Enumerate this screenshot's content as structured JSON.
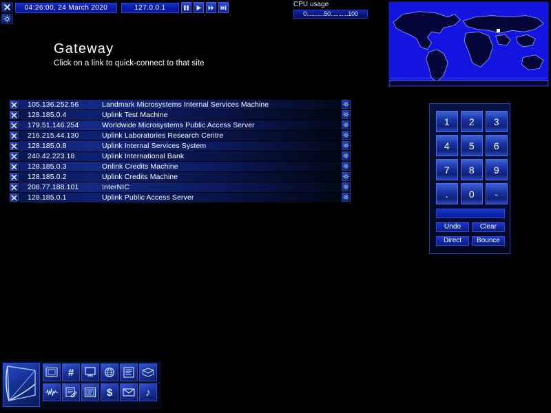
{
  "topbar": {
    "close_icon": "close-icon",
    "gear_icon": "gear-icon",
    "datetime": "04:26:00, 24 March 2020",
    "ip": "127.0.0.1",
    "controls": [
      {
        "name": "pause-button",
        "icon": "pause-icon"
      },
      {
        "name": "play-button",
        "icon": "play-icon"
      },
      {
        "name": "fast-forward-button",
        "icon": "fast-forward-icon"
      },
      {
        "name": "skip-forward-button",
        "icon": "skip-forward-icon"
      }
    ]
  },
  "cpu": {
    "label": "CPU usage",
    "scale": "0...........50...........100"
  },
  "map": {
    "name": "world-map",
    "marker_color": "#ffffff"
  },
  "page": {
    "title": "Gateway",
    "subtitle": "Click on a link to quick-connect to that site"
  },
  "links": [
    {
      "ip": "105.136.252.56",
      "name": "Landmark Microsystems Internal Services Machine"
    },
    {
      "ip": "128.185.0.4",
      "name": "Uplink Test Machine"
    },
    {
      "ip": "179.51.146.254",
      "name": "Worldwide Microsystems Public Access Server"
    },
    {
      "ip": "216.215.44.130",
      "name": "Uplink Laboratories Research Centre"
    },
    {
      "ip": "128.185.0.8",
      "name": "Uplink Internal Services System"
    },
    {
      "ip": "240.42.223.18",
      "name": "Uplink International Bank"
    },
    {
      "ip": "128.185.0.3",
      "name": "Onlink Credits Machine"
    },
    {
      "ip": "128.185.0.2",
      "name": "Uplink Credits Machine"
    },
    {
      "ip": "208.77.188.101",
      "name": "InterNIC"
    },
    {
      "ip": "128.185.0.1",
      "name": "Uplink Public Access Server"
    }
  ],
  "keypad": {
    "keys": [
      "1",
      "2",
      "3",
      "4",
      "5",
      "6",
      "7",
      "8",
      "9",
      ".",
      "0",
      "-"
    ],
    "display_value": "",
    "undo_label": "Undo",
    "clear_label": "Clear",
    "direct_label": "Direct",
    "bounce_label": "Bounce"
  },
  "toolbar": {
    "main_icon": "uplink-logo-icon",
    "items": [
      {
        "name": "hardware-icon",
        "glyph": ""
      },
      {
        "name": "hash-icon",
        "glyph": "#"
      },
      {
        "name": "computer-icon",
        "glyph": ""
      },
      {
        "name": "world-icon",
        "glyph": ""
      },
      {
        "name": "mission-list-icon",
        "glyph": ""
      },
      {
        "name": "news-icon",
        "glyph": ""
      },
      {
        "name": "waveform-icon",
        "glyph": ""
      },
      {
        "name": "notepad-icon",
        "glyph": ""
      },
      {
        "name": "memory-icon",
        "glyph": ""
      },
      {
        "name": "finance-icon",
        "glyph": "$"
      },
      {
        "name": "email-icon",
        "glyph": ""
      },
      {
        "name": "music-icon",
        "glyph": "♪"
      }
    ]
  },
  "colors": {
    "accent": "#1a38d0",
    "panel_border": "#2a44b8",
    "text": "#ffffff",
    "background": "#000000"
  }
}
